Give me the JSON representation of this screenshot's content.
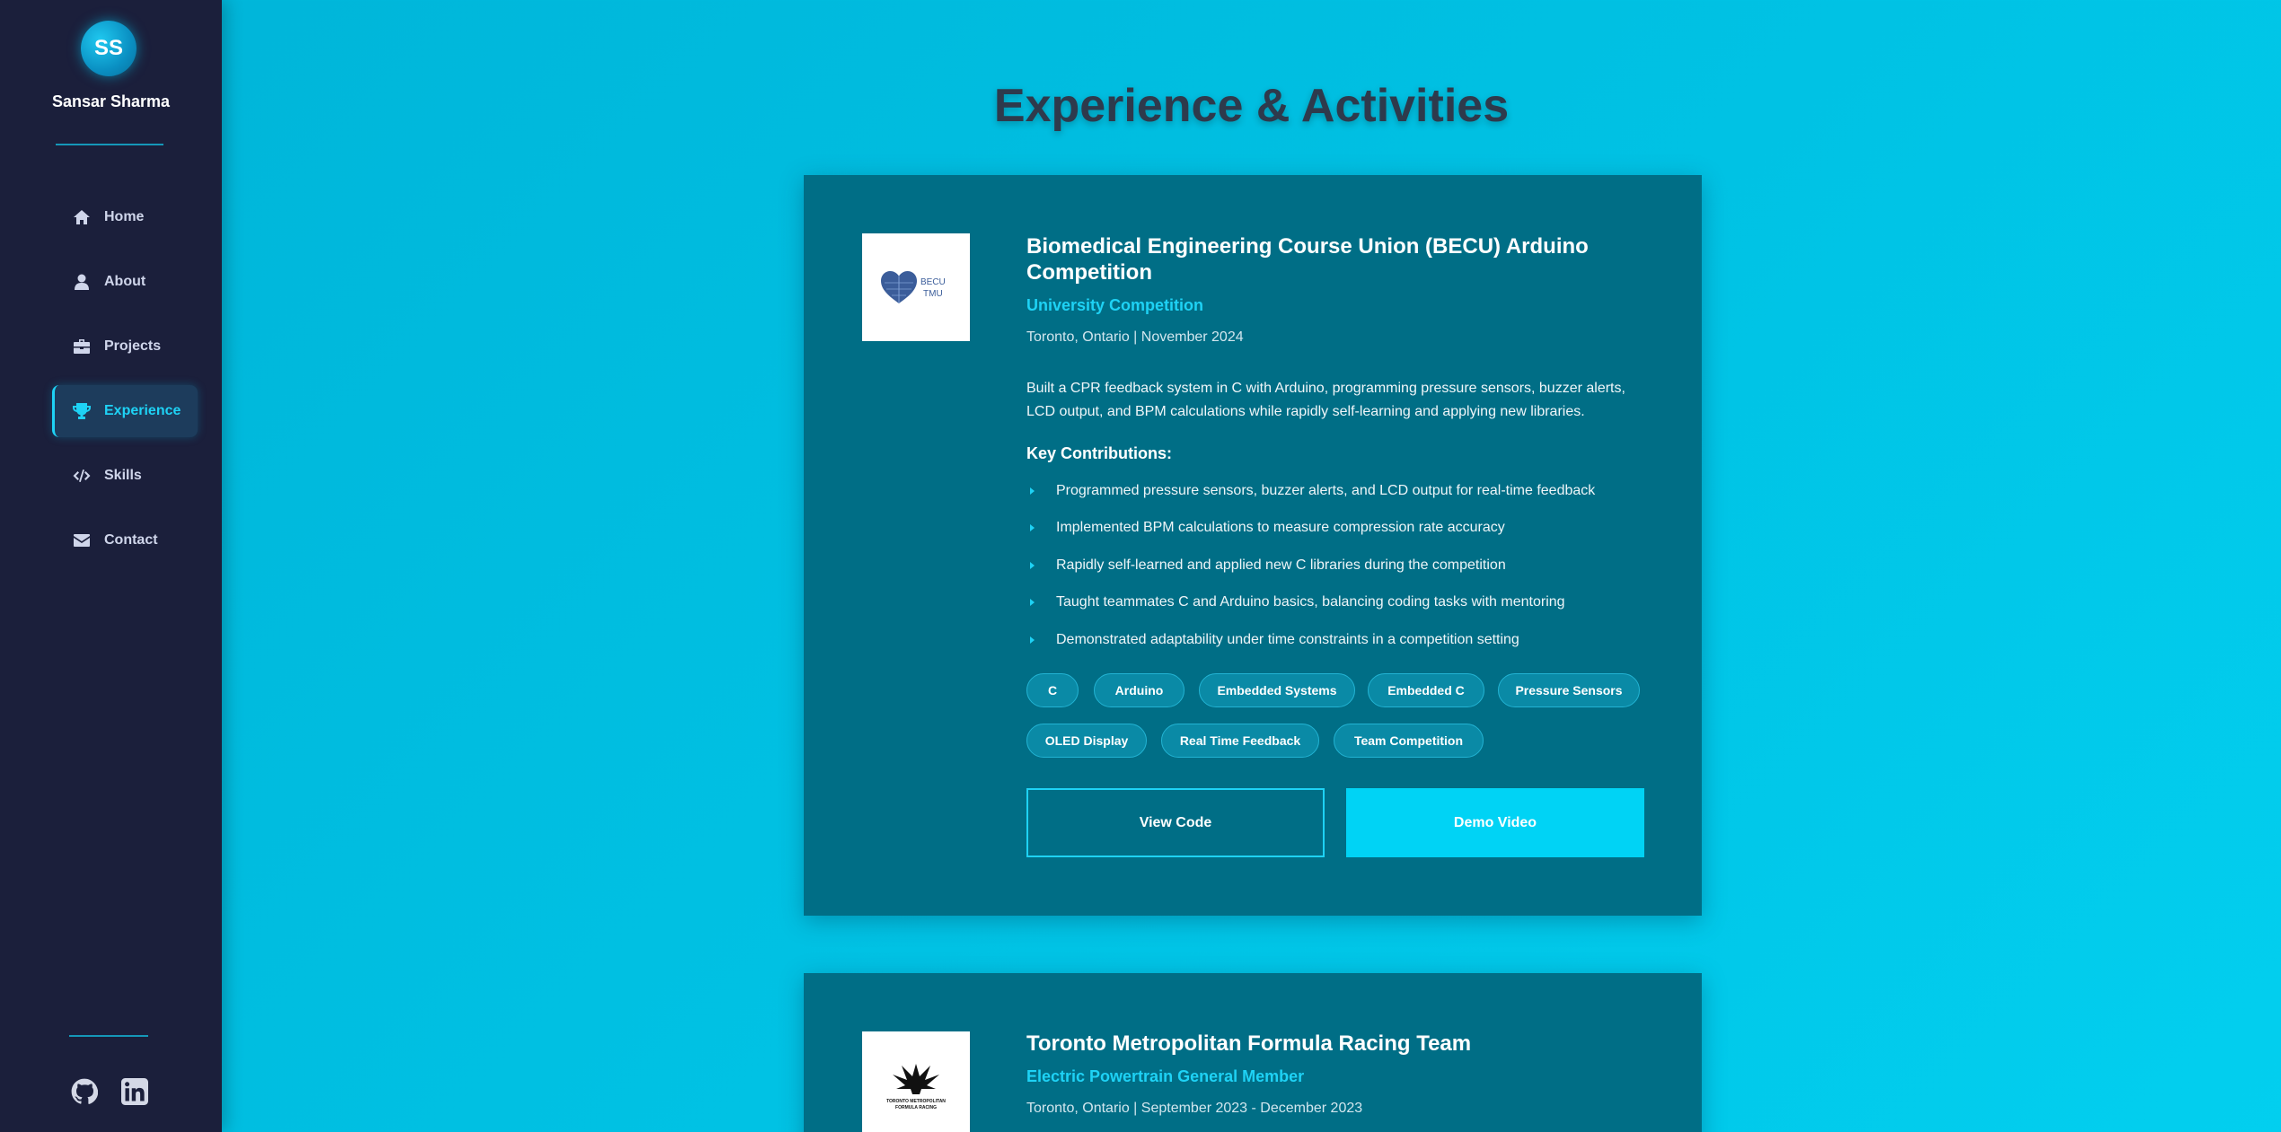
{
  "sidebar": {
    "avatar_initials": "SS",
    "name": "Sansar Sharma",
    "nav": [
      {
        "label": "Home",
        "icon": "home-icon"
      },
      {
        "label": "About",
        "icon": "user-icon"
      },
      {
        "label": "Projects",
        "icon": "briefcase-icon"
      },
      {
        "label": "Experience",
        "icon": "trophy-icon",
        "active": true
      },
      {
        "label": "Skills",
        "icon": "code-icon"
      },
      {
        "label": "Contact",
        "icon": "envelope-icon"
      }
    ],
    "social": [
      {
        "icon": "github-icon"
      },
      {
        "icon": "linkedin-icon"
      }
    ]
  },
  "page": {
    "title": "Experience & Activities"
  },
  "experiences": [
    {
      "logo_text_1": "BECU",
      "logo_text_2": "TMU",
      "title": "Biomedical Engineering Course Union (BECU) Arduino Competition",
      "role": "University Competition",
      "meta": "Toronto, Ontario | November 2024",
      "description": "Built a CPR feedback system in C with Arduino, programming pressure sensors, buzzer alerts, LCD output, and BPM calculations while rapidly self-learning and applying new libraries.",
      "key_heading": "Key Contributions:",
      "contributions": [
        "Programmed pressure sensors, buzzer alerts, and LCD output for real-time feedback",
        "Implemented BPM calculations to measure compression rate accuracy",
        "Rapidly self-learned and applied new C libraries during the competition",
        "Taught teammates C and Arduino basics, balancing coding tasks with mentoring",
        "Demonstrated adaptability under time constraints in a competition setting"
      ],
      "tags": [
        "C",
        "Arduino",
        "Embedded Systems",
        "Embedded C",
        "Pressure Sensors",
        "OLED Display",
        "Real Time Feedback",
        "Team Competition"
      ],
      "buttons": {
        "view_code": "View Code",
        "demo_video": "Demo Video"
      }
    },
    {
      "logo_text_1": "TORONTO METROPOLITAN",
      "logo_text_2": "FORMULA RACING",
      "title": "Toronto Metropolitan Formula Racing Team",
      "role": "Electric Powertrain General Member",
      "meta": "Toronto, Ontario | September 2023 - December 2023"
    }
  ],
  "colors": {
    "sidebar_bg": "#1b1f3b",
    "page_bg": "#00bfe0",
    "card_bg": "#006e86",
    "accent": "#1ed2f5"
  }
}
